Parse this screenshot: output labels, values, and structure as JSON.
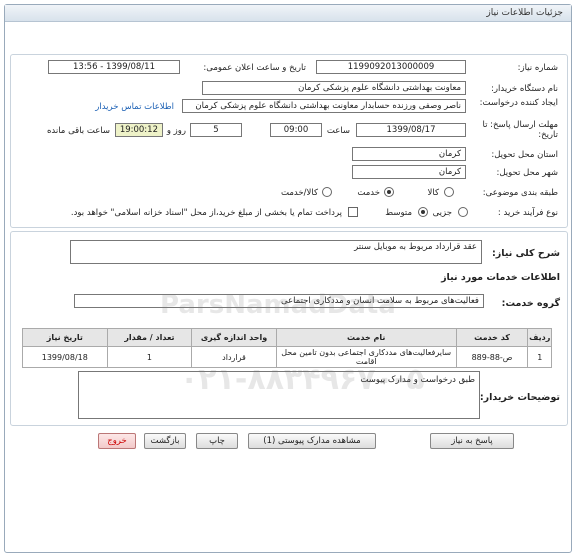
{
  "header": {
    "title": "جزئیات اطلاعات نیاز"
  },
  "fields": {
    "need_number_label": "شماره نیاز:",
    "need_number": "1199092013000009",
    "announce_label": "تاریخ و ساعت اعلان عمومی:",
    "announce_value": "1399/08/11 - 13:56",
    "buyer_label": "نام دستگاه خریدار:",
    "buyer_value": "معاونت بهداشتی دانشگاه علوم پزشکی کرمان",
    "creator_label": "ایجاد کننده درخواست:",
    "creator_value": "ناصر  وصفی ورزنده حسابدار معاونت بهداشتی دانشگاه علوم پزشکی کرمان",
    "contact_link": "اطلاعات تماس خریدار",
    "deadline_label": "مهلت ارسال پاسخ: تا تاریخ:",
    "deadline_date": "1399/08/17",
    "time_label": "ساعت",
    "deadline_time": "09:00",
    "days_value": "5",
    "days_label": "روز و",
    "remaining_time": "19:00:12",
    "remaining_label": "ساعت باقی مانده",
    "province_label": "استان محل تحویل:",
    "province_value": "کرمان",
    "city_label": "شهر محل تحویل:",
    "city_value": "کرمان",
    "category_label": "طبقه بندی موضوعی:",
    "category_opts": [
      "کالا",
      "خدمت",
      "کالا/خدمت"
    ],
    "process_label": "نوع فرآیند خرید :",
    "process_opts": [
      "جزیی",
      "متوسط"
    ],
    "payment_note": "پرداخت تمام یا بخشی از مبلغ خرید،از محل \"اسناد خزانه اسلامی\" خواهد بود."
  },
  "general": {
    "desc_label": "شرح کلی نیاز:",
    "desc_value": "عقد قرارداد مربوط به موبایل سنتر",
    "services_heading": "اطلاعات خدمات مورد نیاز",
    "group_label": "گروه خدمت:",
    "group_value": "فعالیت‌های مربوط به سلامت انسان و مددکاری اجتماعی"
  },
  "table": {
    "headers": [
      "ردیف",
      "کد خدمت",
      "نام خدمت",
      "واحد اندازه گیری",
      "تعداد / مقدار",
      "تاریخ نیاز"
    ],
    "rows": [
      [
        "1",
        "ص-88-889",
        "سایرفعالیت‌های مددکاری اجتماعی بدون تامین محل اقامت",
        "قرارداد",
        "1",
        "1399/08/18"
      ]
    ]
  },
  "buyer_notes": {
    "label": "توضیحات خریدار:",
    "value": "طبق درخواست و مدارک پیوست"
  },
  "buttons": {
    "reply": "پاسخ به نیاز",
    "attachments": "مشاهده مدارک پیوستی (1)",
    "print": "چاپ",
    "back": "بازگشت",
    "exit": "خروج"
  },
  "watermark": {
    "brand": "ParsNamadData",
    "phone": "۰۲۱-۸۸۳۴۹۶۷۰-۵"
  }
}
